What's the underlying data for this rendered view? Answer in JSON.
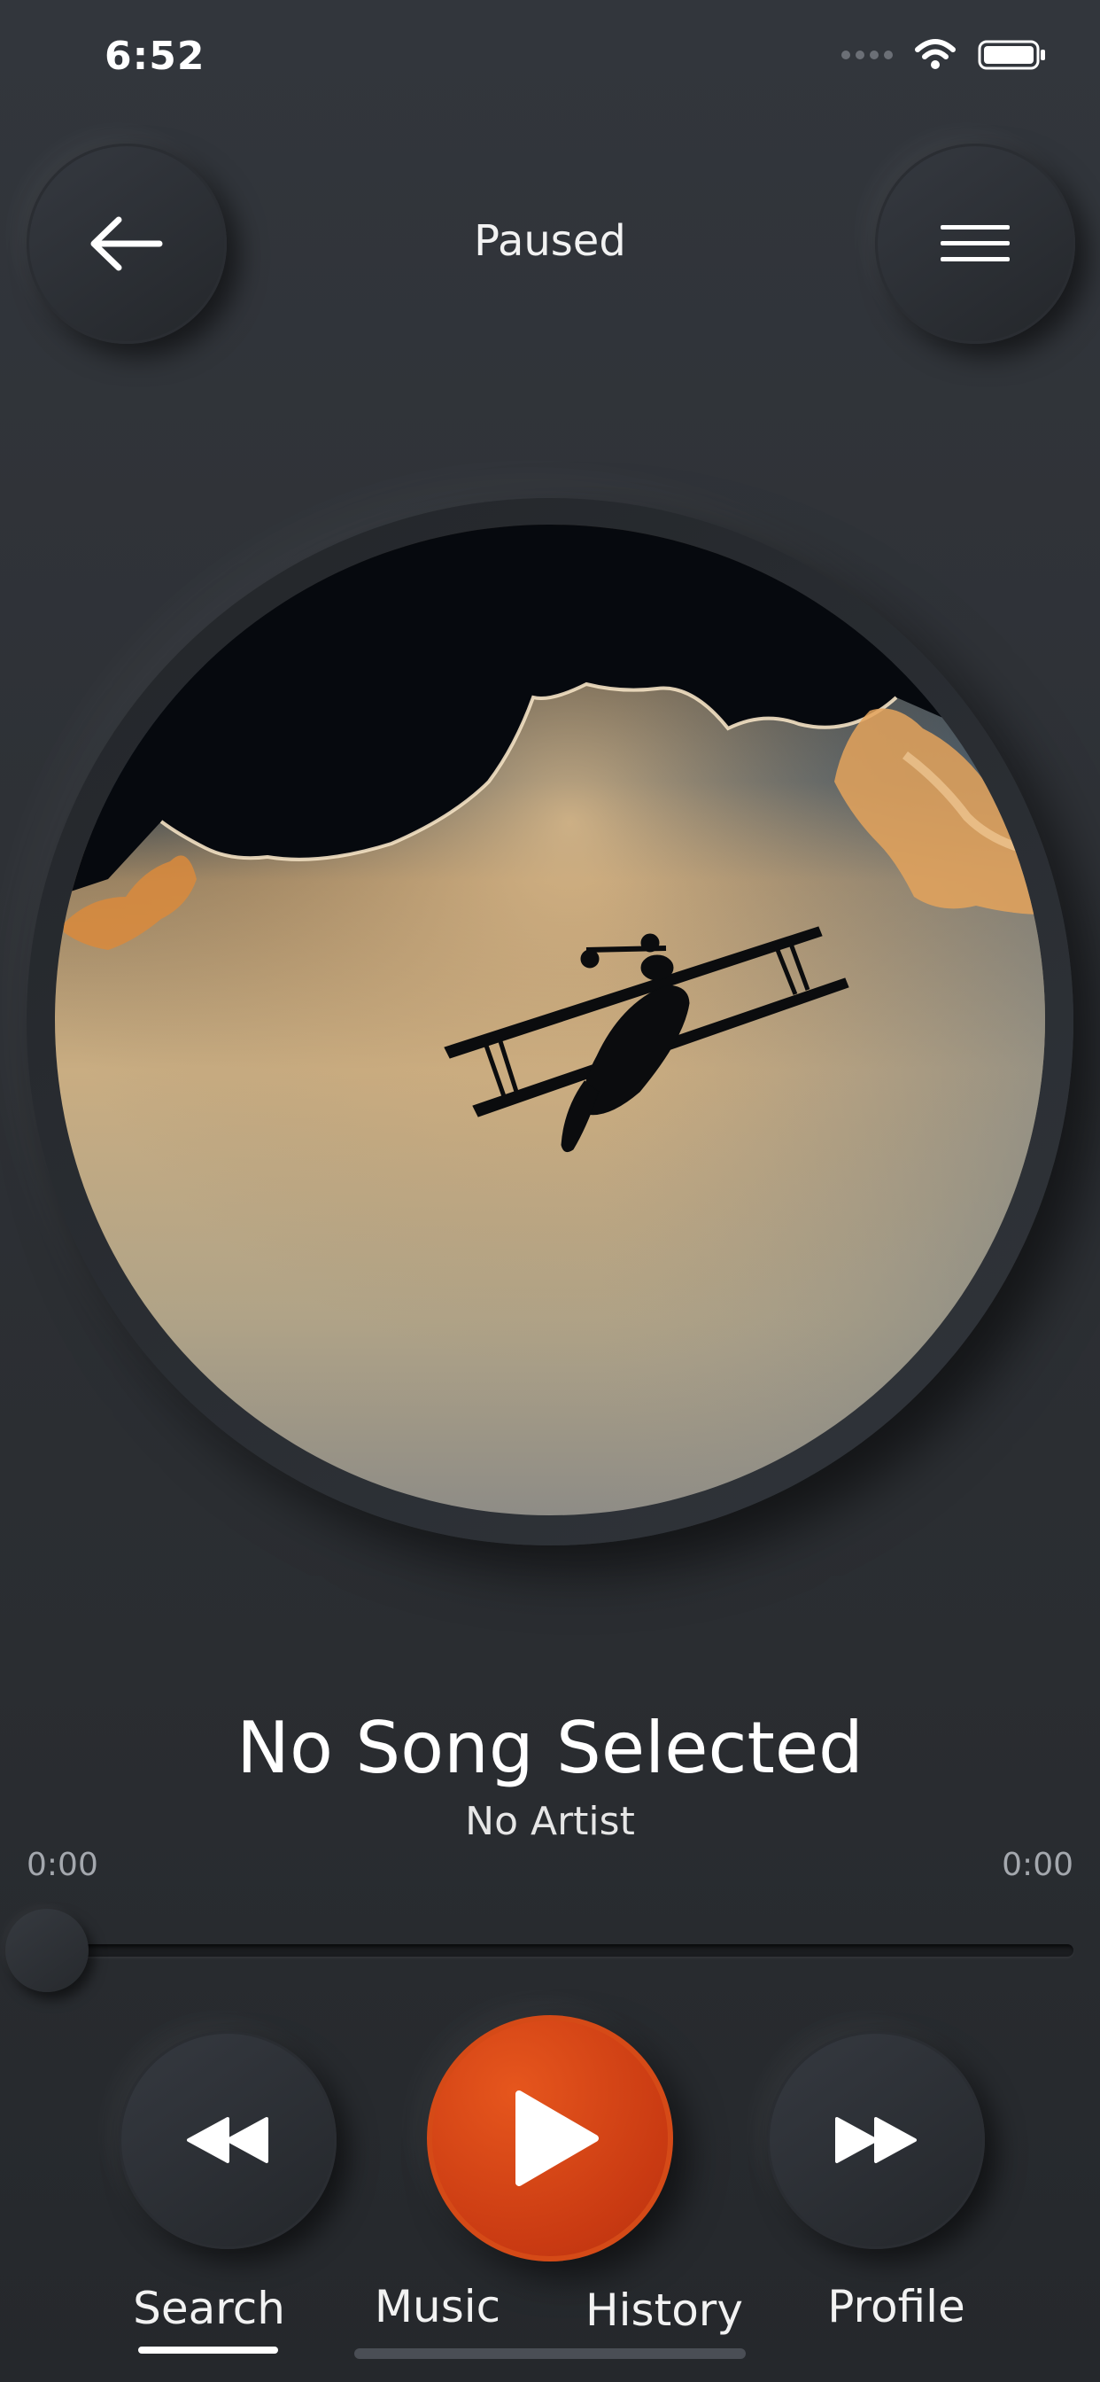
{
  "status_bar": {
    "time": "6:52",
    "icons": [
      "cellular-signal-icon",
      "wifi-icon",
      "battery-icon"
    ]
  },
  "header": {
    "title": "Paused",
    "back_icon": "arrow-left-icon",
    "menu_icon": "hamburger-menu-icon"
  },
  "artwork": {
    "subject": "biplane silhouette against sunlit clouds"
  },
  "now_playing": {
    "title": "No Song Selected",
    "artist": "No Artist",
    "elapsed": "0:00",
    "duration": "0:00",
    "progress": 0
  },
  "controls": {
    "rewind_icon": "rewind-icon",
    "play_icon": "play-icon",
    "forward_icon": "fast-forward-icon"
  },
  "tabs": [
    {
      "label": "Search",
      "active": true
    },
    {
      "label": "Music",
      "active": false
    },
    {
      "label": "History",
      "active": false
    },
    {
      "label": "Profile",
      "active": false
    }
  ],
  "colors": {
    "background": "#2b2e33",
    "accent": "#d8441a",
    "text": "#ffffff",
    "muted_text": "#a4a8ae"
  }
}
